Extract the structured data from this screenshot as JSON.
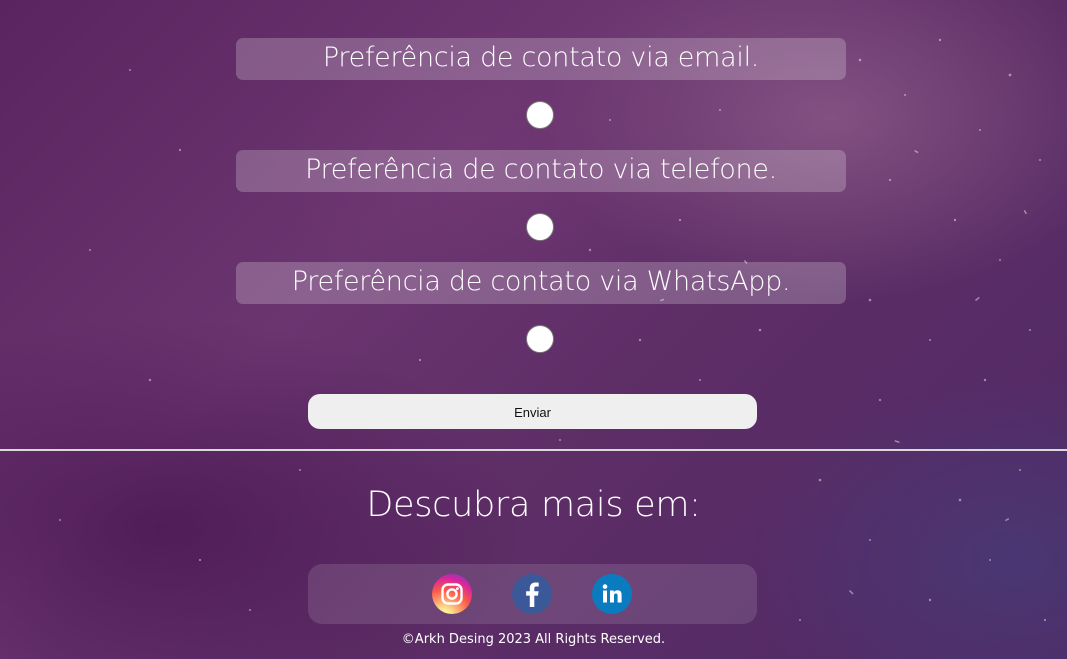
{
  "form": {
    "options": [
      {
        "label": "Preferência de contato via email.",
        "selected": false
      },
      {
        "label": "Preferência de contato via telefone.",
        "selected": false
      },
      {
        "label": "Preferência de contato via WhatsApp.",
        "selected": false
      }
    ],
    "submit_label": "Enviar"
  },
  "footer": {
    "discover_title": "Descubra mais em:",
    "social": [
      {
        "icon": "instagram-icon",
        "color": "#d6249f"
      },
      {
        "icon": "facebook-icon",
        "color": "#3b5998"
      },
      {
        "icon": "linkedin-icon",
        "color": "#0a7bbf"
      }
    ],
    "copyright": "©Arkh Desing 2023 All Rights Reserved."
  }
}
